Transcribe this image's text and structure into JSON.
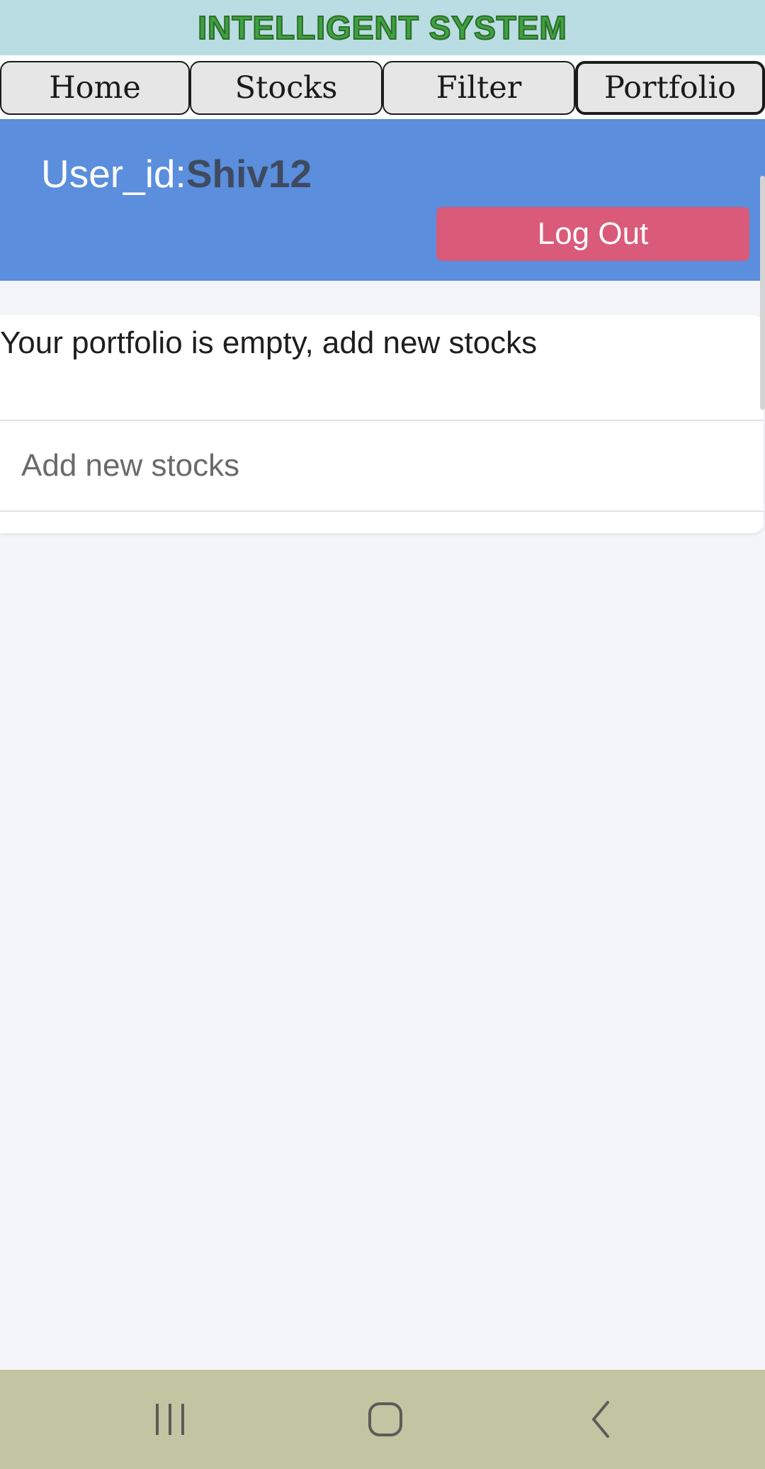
{
  "app": {
    "title": "INTELLIGENT SYSTEM"
  },
  "nav": {
    "tabs": [
      {
        "label": "Home"
      },
      {
        "label": "Stocks"
      },
      {
        "label": "Filter"
      },
      {
        "label": "Portfolio",
        "active": true
      }
    ]
  },
  "user": {
    "label": "User_id:",
    "value": "Shiv12",
    "logout_label": "Log Out"
  },
  "portfolio": {
    "empty_message": "Your portfolio is empty, add new stocks",
    "add_label": "Add new stocks"
  },
  "system_nav": {
    "icons": [
      "recent-apps-icon",
      "home-icon",
      "back-icon"
    ]
  },
  "colors": {
    "title_bar": "#b9dde2",
    "title_text": "#3fa142",
    "header": "#5b8edc",
    "logout": "#d95b79",
    "system_nav": "#c3c4a1"
  }
}
